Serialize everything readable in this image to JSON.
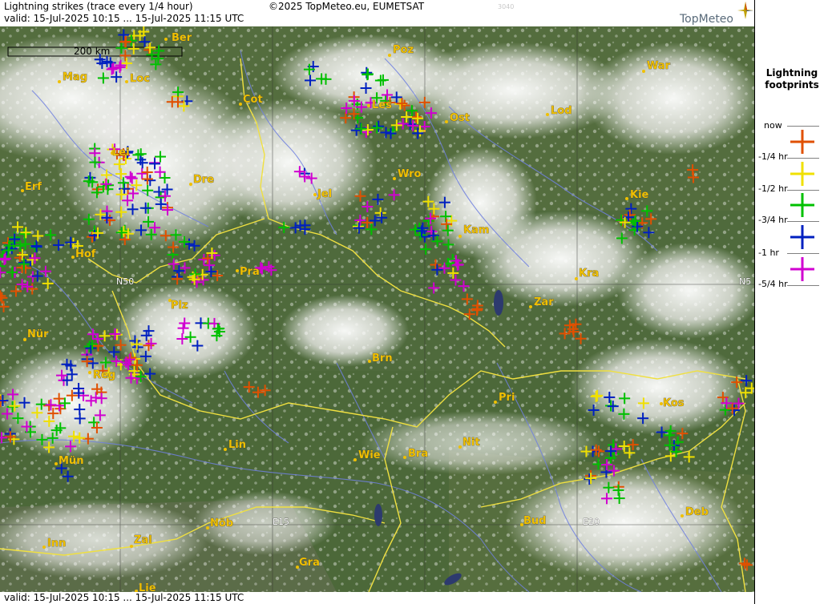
{
  "header": {
    "title": "Lightning strikes (trace every 1/4 hour)",
    "valid": "valid:  15-Jul-2025 10:15 ... 15-Jul-2025 11:15 UTC",
    "copyright": "©2025 TopMeteo.eu, EUMETSAT",
    "code": "3040",
    "logo": "TopMeteo"
  },
  "footer": {
    "valid": "valid:  15-Jul-2025 10:15 ... 15-Jul-2025 11:15 UTC"
  },
  "scale": {
    "label": "200 km"
  },
  "grid_labels": [
    {
      "text": "N50"
    },
    {
      "text": "N5"
    },
    {
      "text": "E15"
    },
    {
      "text": "E20"
    }
  ],
  "cities": [
    {
      "name": "Ber"
    },
    {
      "name": "Mag"
    },
    {
      "name": "Loc"
    },
    {
      "name": "Cot"
    },
    {
      "name": "Poz"
    },
    {
      "name": "War"
    },
    {
      "name": "Les"
    },
    {
      "name": "Ost"
    },
    {
      "name": "Lod"
    },
    {
      "name": "Lei"
    },
    {
      "name": "Dre"
    },
    {
      "name": "Erf"
    },
    {
      "name": "Wro"
    },
    {
      "name": "Jel"
    },
    {
      "name": "Kie"
    },
    {
      "name": "Kam"
    },
    {
      "name": "Hof"
    },
    {
      "name": "Pra"
    },
    {
      "name": "Kra"
    },
    {
      "name": "Plz"
    },
    {
      "name": "Zar"
    },
    {
      "name": "Nür"
    },
    {
      "name": "Brn"
    },
    {
      "name": "Reg"
    },
    {
      "name": "Pri"
    },
    {
      "name": "Kos"
    },
    {
      "name": "Lin"
    },
    {
      "name": "Nit"
    },
    {
      "name": "Wie"
    },
    {
      "name": "Bra"
    },
    {
      "name": "Mün"
    },
    {
      "name": "Bud"
    },
    {
      "name": "Nöb"
    },
    {
      "name": "Deb"
    },
    {
      "name": "Inn"
    },
    {
      "name": "Zal"
    },
    {
      "name": "Gra"
    },
    {
      "name": "Lie"
    }
  ],
  "legend": {
    "title_line1": "Lightning",
    "title_line2": "footprints",
    "items": [
      {
        "label": "now",
        "color": "#e05000"
      },
      {
        "label": "-1/4 hr",
        "color": "#f0e000"
      },
      {
        "label": "-1/2 hr",
        "color": "#00c000"
      },
      {
        "label": "-3/4 hr",
        "color": "#0020c0"
      },
      {
        "label": "-1 hr",
        "color": "#d000d0"
      },
      {
        "label": "-5/4 hr",
        "color": ""
      }
    ]
  },
  "colors": {
    "city_text": "#f0c000",
    "border": "#f0e040",
    "river": "#7080e0",
    "strike_now": "#e05000",
    "strike_15": "#f0e000",
    "strike_30": "#00c000",
    "strike_45": "#0020c0",
    "strike_60": "#d000d0"
  }
}
